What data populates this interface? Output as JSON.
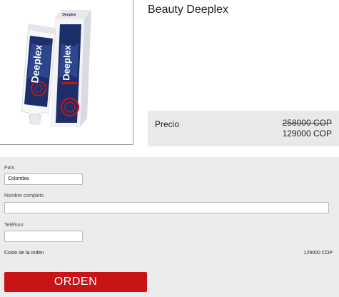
{
  "product": {
    "title": "Beauty Deeplex",
    "image": {
      "tube_brand": "Deeplex",
      "box_brand": "Deeplex",
      "box_top_label": "Deeplex"
    },
    "price_label": "Precio",
    "old_price": "258000 COP",
    "new_price": "129000 COP"
  },
  "form": {
    "country_label": "País",
    "country_value": "Colombia",
    "name_label": "Nombre completo",
    "name_value": "",
    "phone_label": "Teléfono",
    "phone_value": "",
    "order_cost_label": "Costo de la orden",
    "order_cost_value": "129000 COP",
    "submit_label": "ORDEN"
  },
  "colors": {
    "accent_red": "#c81317",
    "navy": "#1d2f6b",
    "panel_gray": "#e9e9e9",
    "form_bg": "#ececec"
  }
}
